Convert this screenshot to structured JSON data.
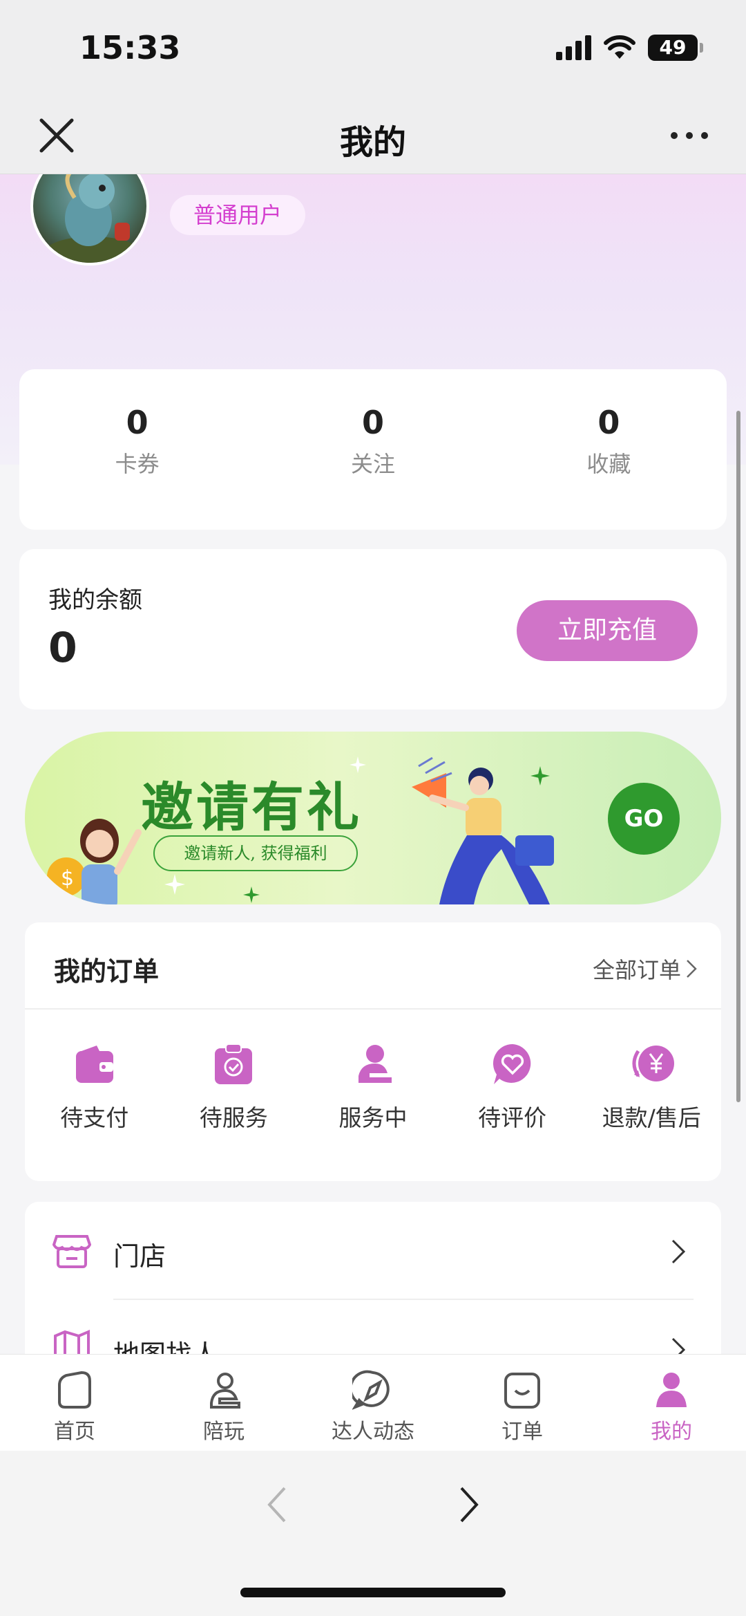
{
  "status_bar": {
    "time": "15:33",
    "battery": "49"
  },
  "nav": {
    "title": "我的",
    "close_icon": "close-icon",
    "more_icon": "more-icon"
  },
  "profile": {
    "badge": "普通用户"
  },
  "stats": [
    {
      "value": "0",
      "label": "卡券"
    },
    {
      "value": "0",
      "label": "关注"
    },
    {
      "value": "0",
      "label": "收藏"
    }
  ],
  "balance": {
    "label": "我的余额",
    "value": "0",
    "recharge_label": "立即充值"
  },
  "banner": {
    "title": "邀请有礼",
    "subtitle": "邀请新人, 获得福利",
    "go_label": "GO"
  },
  "orders": {
    "title": "我的订单",
    "all_label": "全部订单",
    "items": [
      {
        "label": "待支付",
        "icon": "wallet-icon"
      },
      {
        "label": "待服务",
        "icon": "clipboard-check-icon"
      },
      {
        "label": "服务中",
        "icon": "person-icon"
      },
      {
        "label": "待评价",
        "icon": "heart-chat-icon"
      },
      {
        "label": "退款/售后",
        "icon": "refund-yen-icon"
      }
    ]
  },
  "menu": [
    {
      "label": "门店",
      "icon": "store-icon"
    },
    {
      "label": "地图找人",
      "icon": "map-icon"
    }
  ],
  "tabs": [
    {
      "label": "首页",
      "icon": "home-icon"
    },
    {
      "label": "陪玩",
      "icon": "companion-icon"
    },
    {
      "label": "达人动态",
      "icon": "compass-icon"
    },
    {
      "label": "订单",
      "icon": "order-icon"
    },
    {
      "label": "我的",
      "icon": "profile-icon",
      "active": true
    }
  ],
  "colors": {
    "accent": "#c964c4",
    "badge_text": "#d43fcf",
    "banner_green": "#2b8a2a"
  }
}
